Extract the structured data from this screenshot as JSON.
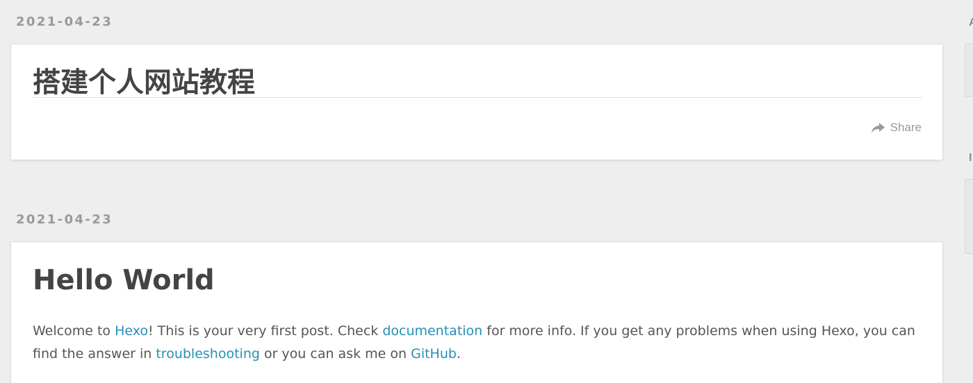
{
  "posts": [
    {
      "date": "2021-04-23",
      "title": "搭建个人网站教程",
      "share_label": "Share"
    },
    {
      "date": "2021-04-23",
      "title": "Hello World",
      "excerpt": {
        "t1": "Welcome to ",
        "link_hexo": "Hexo",
        "t2": "! This is your very first post. Check ",
        "link_docs": "documentation",
        "t3": " for more info. If you get any problems when using Hexo, you can find the answer in ",
        "link_troubleshooting": "troubleshooting",
        "t4": " or you can ask me on ",
        "link_github": "GitHub",
        "t5": "."
      }
    }
  ],
  "sidebar": {
    "heading_1": "A",
    "heading_2": "I"
  },
  "colors": {
    "background": "#eeeeee",
    "card": "#ffffff",
    "link": "#258fb8",
    "title": "#444444",
    "date": "#999999"
  },
  "icons": {
    "share": "share-arrow-icon"
  }
}
